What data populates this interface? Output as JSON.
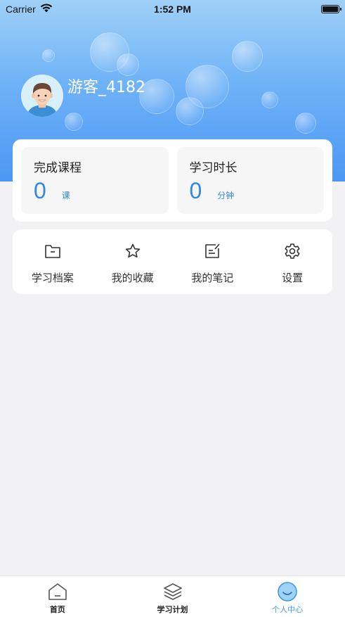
{
  "status_bar": {
    "carrier": "Carrier",
    "time": "1:52 PM"
  },
  "profile": {
    "username": "游客_4182"
  },
  "stats": [
    {
      "title": "完成课程",
      "value": "0",
      "unit": "课"
    },
    {
      "title": "学习时长",
      "value": "0",
      "unit": "分钟"
    }
  ],
  "menu": [
    {
      "label": "学习档案",
      "icon": "folder-icon"
    },
    {
      "label": "我的收藏",
      "icon": "star-icon"
    },
    {
      "label": "我的笔记",
      "icon": "note-icon"
    },
    {
      "label": "设置",
      "icon": "gear-icon"
    }
  ],
  "tabs": [
    {
      "label": "首页",
      "icon": "home-icon",
      "active": false
    },
    {
      "label": "学习计划",
      "icon": "layers-icon",
      "active": false
    },
    {
      "label": "个人中心",
      "icon": "smile-icon",
      "active": true
    }
  ],
  "colors": {
    "accent": "#2f87e6",
    "tab_active": "#3d9ae8",
    "header_top": "#9fd0f7",
    "header_bottom": "#4c97f4"
  }
}
